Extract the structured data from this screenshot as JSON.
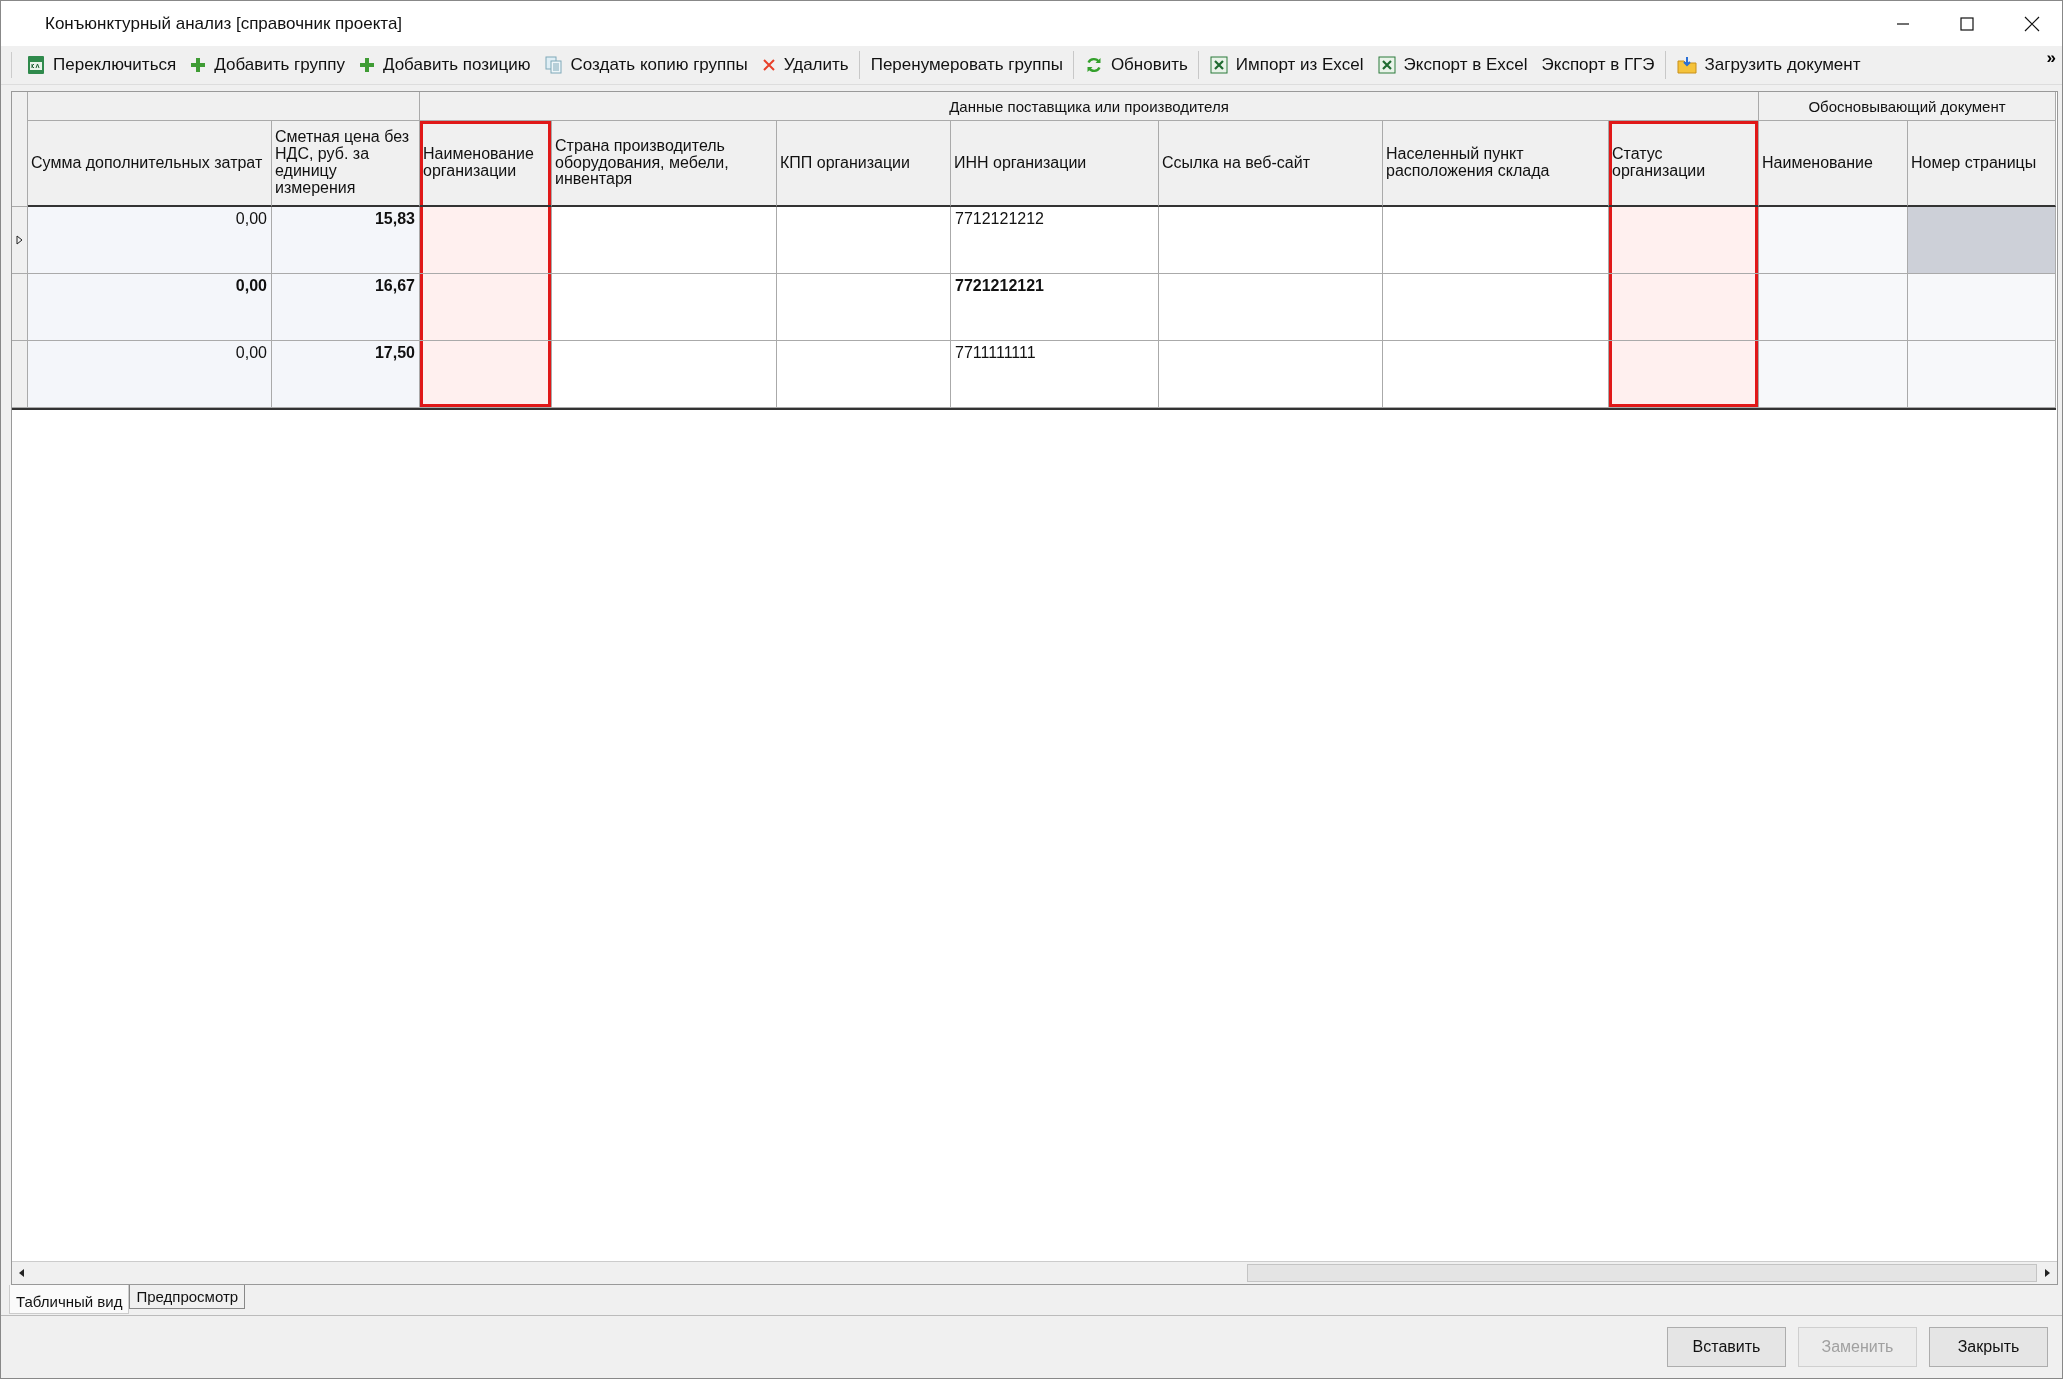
{
  "window": {
    "title": "Конъюнктурный анализ [справочник проекта]"
  },
  "toolbar": [
    {
      "label": "Переключиться",
      "kind": "switch",
      "separator_after": false
    },
    {
      "label": "Добавить группу",
      "kind": "add",
      "separator_after": false
    },
    {
      "label": "Добавить позицию",
      "kind": "add",
      "separator_after": false
    },
    {
      "label": "Создать копию группы",
      "kind": "duplicate",
      "separator_after": false
    },
    {
      "label": "Удалить",
      "kind": "remove",
      "separator_after": true
    },
    {
      "label": "Перенумеровать группы",
      "kind": "text",
      "separator_after": true
    },
    {
      "label": "Обновить",
      "kind": "reload",
      "separator_after": true
    },
    {
      "label": "Импорт из Excel",
      "kind": "sheet",
      "separator_after": false
    },
    {
      "label": "Экспорт в Excel",
      "kind": "sheet",
      "separator_after": false
    },
    {
      "label": "Экспорт в ГГЭ",
      "kind": "text",
      "separator_after": true
    },
    {
      "label": "Загрузить документ",
      "kind": "upload",
      "separator_after": false
    }
  ],
  "toolbar_overflow": "»",
  "table": {
    "column_groups": [
      {
        "kind": "costs",
        "columns": [
          {
            "title": "Сумма дополнительных затрат",
            "kind": "number",
            "highlighted": false
          },
          {
            "title": "Сметная цена без НДС, руб. за единицу измерения",
            "kind": "number",
            "highlighted": false
          }
        ]
      },
      {
        "kind": "supplier",
        "title": "Данные поставщика или производителя",
        "columns": [
          {
            "title": "Наименование организации",
            "kind": "text",
            "highlighted": true
          },
          {
            "title": "Страна производитель оборудования, мебели, инвентаря",
            "kind": "text",
            "highlighted": false
          },
          {
            "title": "КПП организации",
            "kind": "text",
            "highlighted": false
          },
          {
            "title": "ИНН организации",
            "kind": "text",
            "highlighted": false
          },
          {
            "title": "Ссылка на веб-сайт",
            "kind": "text",
            "highlighted": false
          },
          {
            "title": "Населенный пункт расположения склада",
            "kind": "text",
            "highlighted": false
          },
          {
            "title": "Статус организации",
            "kind": "text",
            "highlighted": true
          }
        ]
      },
      {
        "kind": "document",
        "title": "Обосновывающий документ",
        "columns": [
          {
            "title": "Наименование",
            "kind": "text",
            "highlighted": false
          },
          {
            "title": "Номер страницы",
            "kind": "text",
            "highlighted": false
          }
        ]
      }
    ],
    "rows": [
      {
        "current": true,
        "cells": [
          {
            "text": "0,00",
            "bold": false,
            "selected": false
          },
          {
            "text": "15,83",
            "bold": true,
            "selected": false
          },
          {
            "selected": false
          },
          {
            "selected": false
          },
          {
            "selected": false
          },
          {
            "text": "7712121212",
            "bold": false,
            "selected": false
          },
          {
            "selected": false
          },
          {
            "selected": false
          },
          {
            "selected": false
          },
          {
            "selected": false
          },
          {
            "selected": true
          }
        ]
      },
      {
        "current": false,
        "cells": [
          {
            "text": "0,00",
            "bold": true,
            "selected": false
          },
          {
            "text": "16,67",
            "bold": true,
            "selected": false
          },
          {
            "selected": false
          },
          {
            "selected": false
          },
          {
            "selected": false
          },
          {
            "text": "7721212121",
            "bold": true,
            "selected": false
          },
          {
            "selected": false
          },
          {
            "selected": false
          },
          {
            "selected": false
          },
          {
            "selected": false
          },
          {
            "selected": false
          }
        ]
      },
      {
        "current": false,
        "cells": [
          {
            "text": "0,00",
            "bold": false,
            "selected": false
          },
          {
            "text": "17,50",
            "bold": true,
            "selected": false
          },
          {
            "selected": false
          },
          {
            "selected": false
          },
          {
            "selected": false
          },
          {
            "text": "7711111111",
            "bold": false,
            "selected": false
          },
          {
            "selected": false
          },
          {
            "selected": false
          },
          {
            "selected": false
          },
          {
            "selected": false
          },
          {
            "selected": false
          }
        ]
      }
    ]
  },
  "view_tabs": [
    {
      "label": "Табличный вид",
      "selected": true
    },
    {
      "label": "Предпросмотр",
      "selected": false
    }
  ],
  "buttons": [
    {
      "label": "Вставить",
      "disabled": false
    },
    {
      "label": "Заменить",
      "disabled": true
    },
    {
      "label": "Закрыть",
      "disabled": false
    }
  ]
}
